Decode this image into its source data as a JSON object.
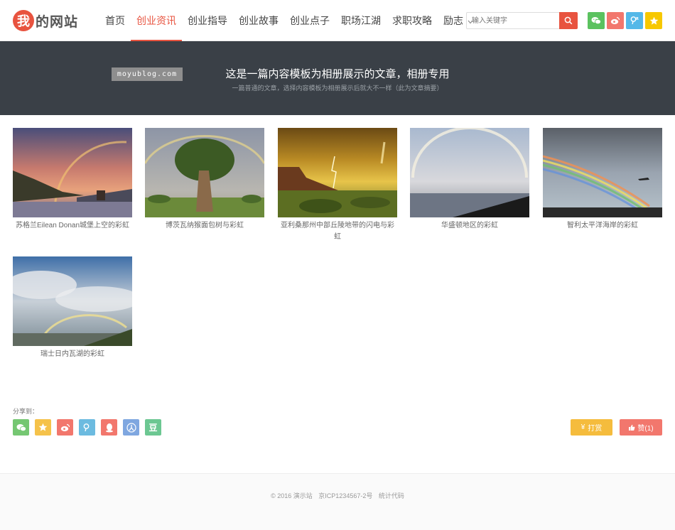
{
  "header": {
    "logo_mark": "我",
    "logo_text": "的网站",
    "nav": [
      {
        "label": "首页"
      },
      {
        "label": "创业资讯",
        "active": true
      },
      {
        "label": "创业指导"
      },
      {
        "label": "创业故事"
      },
      {
        "label": "创业点子"
      },
      {
        "label": "职场江湖"
      },
      {
        "label": "求职攻略"
      },
      {
        "label": "励志"
      }
    ],
    "search_placeholder": "输入关键字",
    "social": [
      {
        "icon": "wechat-icon",
        "color": "#5bc25f"
      },
      {
        "icon": "weibo-icon",
        "color": "#f2776d"
      },
      {
        "icon": "tencent-weibo-icon",
        "color": "#54b8e8"
      },
      {
        "icon": "star-icon",
        "color": "#f7c800"
      }
    ]
  },
  "banner": {
    "watermark": "moyublog.com",
    "title": "这是一篇内容模板为相册展示的文章，相册专用",
    "subtitle": "一篇普通的文章，选择内容模板为相册展示后就大不一样（此为文章摘要）"
  },
  "gallery": [
    {
      "caption": "苏格兰Eilean Donan城堡上空的彩虹"
    },
    {
      "caption": "博茨瓦纳猴面包树与彩虹"
    },
    {
      "caption": "亚利桑那州中部丘陵地带的闪电与彩虹"
    },
    {
      "caption": "华盛顿地区的彩虹"
    },
    {
      "caption": "智利太平洋海岸的彩虹"
    },
    {
      "caption": "瑞士日内瓦湖的彩虹"
    }
  ],
  "share": {
    "label": "分享到：",
    "icons": [
      {
        "icon": "wechat-icon",
        "color": "#75c772"
      },
      {
        "icon": "star-icon",
        "color": "#f5c24a"
      },
      {
        "icon": "weibo-icon",
        "color": "#f2776d"
      },
      {
        "icon": "tencent-weibo-icon",
        "color": "#6cbbe0"
      },
      {
        "icon": "qq-icon",
        "color": "#f2776d"
      },
      {
        "icon": "renren-icon",
        "color": "#7fa7e0"
      },
      {
        "icon": "douban-icon",
        "color": "#6cc792",
        "glyph": "豆"
      }
    ],
    "reward_label": "打赏",
    "like_label": "赞(1)"
  },
  "footer": {
    "copyright": "© 2016 演示站",
    "icp": "京ICP1234567-2号",
    "stats": "统计代码"
  }
}
